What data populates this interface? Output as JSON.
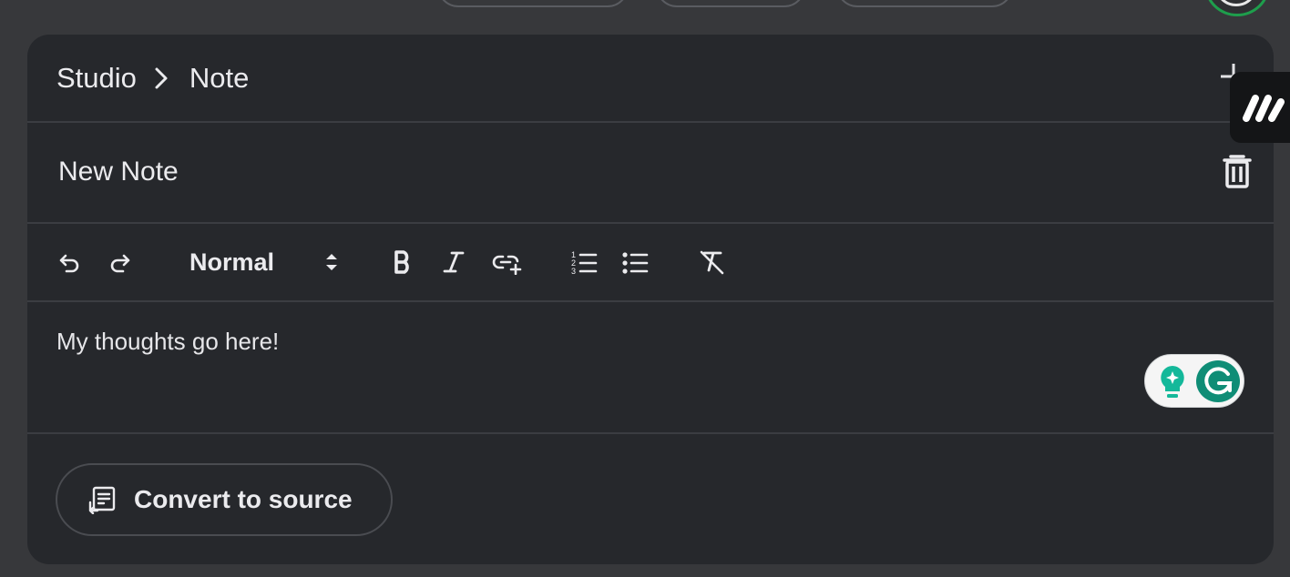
{
  "breadcrumb": {
    "root": "Studio",
    "current": "Note"
  },
  "note": {
    "title": "New Note",
    "body": "My thoughts go here!"
  },
  "toolbar": {
    "style_value": "Normal",
    "undo_icon": "undo-icon",
    "redo_icon": "redo-icon",
    "bold_icon": "bold-icon",
    "italic_icon": "italic-icon",
    "link_icon": "insert-link-icon",
    "numbered_list_icon": "numbered-list-icon",
    "bulleted_list_icon": "bulleted-list-icon",
    "clear_format_icon": "clear-formatting-icon"
  },
  "actions": {
    "convert_label": "Convert to source",
    "convert_icon": "convert-to-source-icon"
  },
  "colors": {
    "background": "#37383b",
    "panel": "#26282c",
    "text": "#ebebee",
    "grammarly_green": "#0f8d76",
    "avatar_ring": "#1e9e4c"
  }
}
